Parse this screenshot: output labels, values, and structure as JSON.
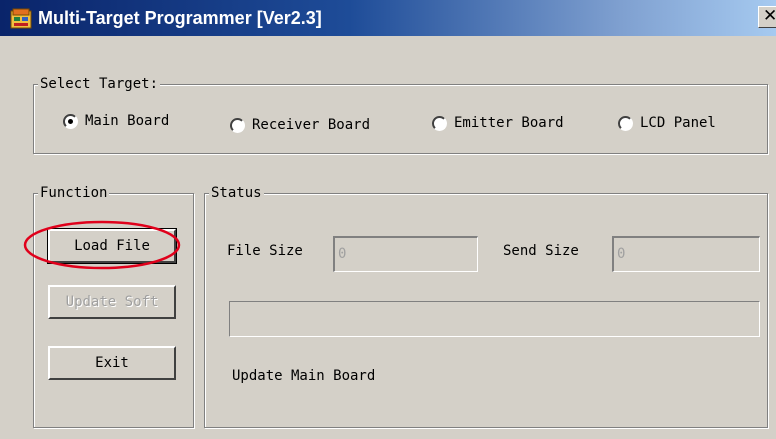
{
  "window": {
    "title": "Multi-Target Programmer [Ver2.3]",
    "close_glyph": "✕"
  },
  "select_target": {
    "label": "Select Target:",
    "options": [
      {
        "label": "Main Board",
        "selected": true
      },
      {
        "label": "Receiver Board",
        "selected": false
      },
      {
        "label": "Emitter Board",
        "selected": false
      },
      {
        "label": "LCD Panel",
        "selected": false
      }
    ]
  },
  "function": {
    "label": "Function",
    "buttons": [
      {
        "label": "Load File",
        "enabled": true,
        "highlighted": true
      },
      {
        "label": "Update Soft",
        "enabled": false,
        "highlighted": false
      },
      {
        "label": "Exit",
        "enabled": true,
        "highlighted": false
      }
    ]
  },
  "status": {
    "label": "Status",
    "file_size_label": "File Size",
    "file_size_value": "0",
    "send_size_label": "Send Size",
    "send_size_value": "0",
    "progress": 0,
    "message": "Update Main Board"
  },
  "colors": {
    "title_gradient_start": "#0a246a",
    "title_gradient_end": "#a6caf0",
    "face": "#d4d0c8",
    "highlight_circle": "#e0001b"
  },
  "icons": {
    "app": "programmer-app-icon",
    "close": "close-icon"
  }
}
